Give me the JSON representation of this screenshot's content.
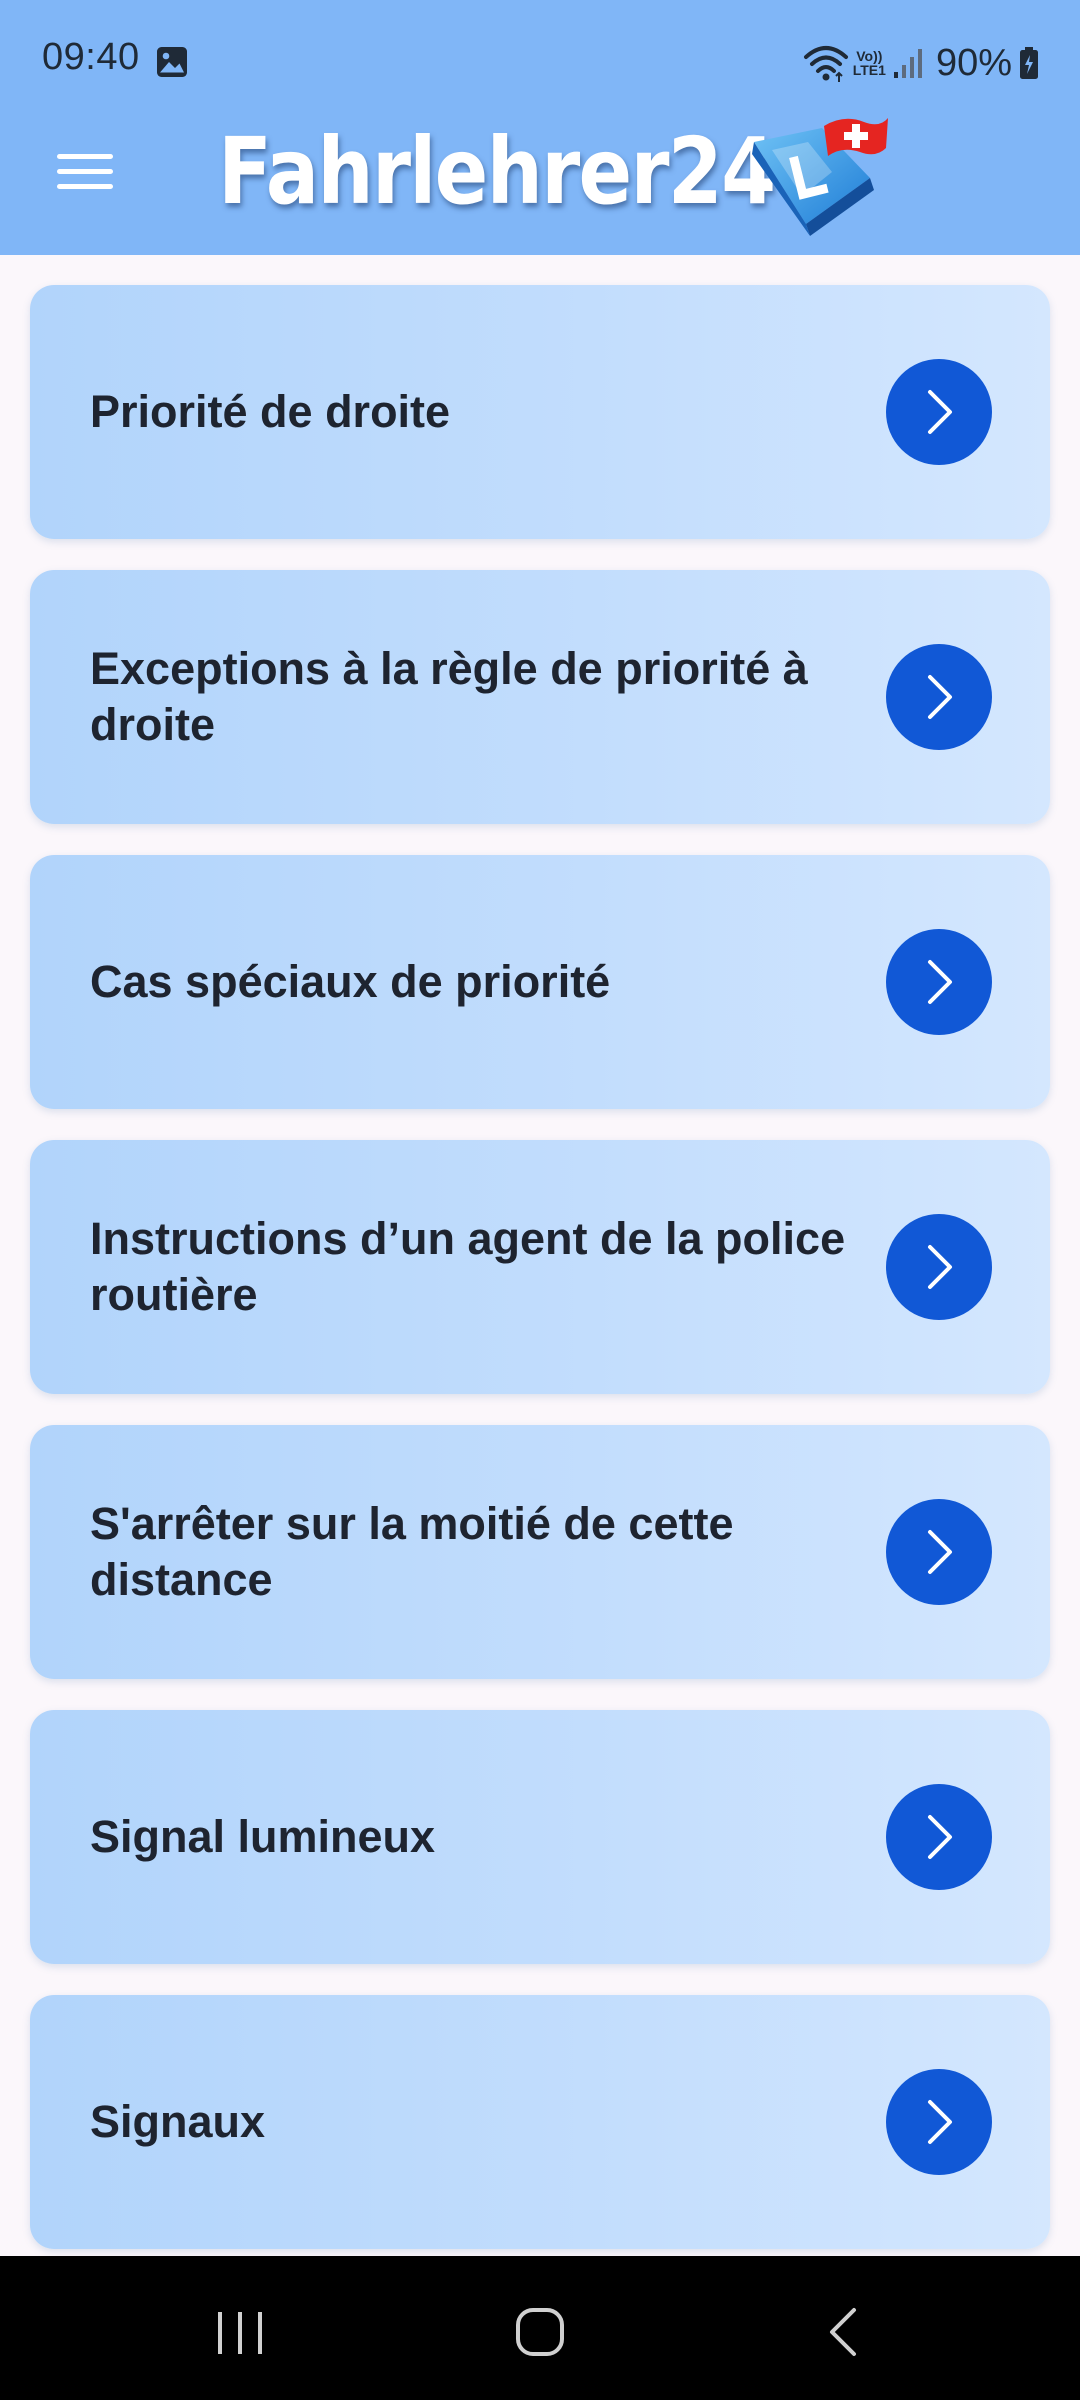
{
  "status_bar": {
    "time": "09:40",
    "network_label_top": "Vo))",
    "network_label_bottom": "LTE1",
    "battery_percent": "90%",
    "icons": [
      "gallery-icon",
      "wifi-icon",
      "signal-icon",
      "battery-charging-icon"
    ]
  },
  "app_bar": {
    "title": "Fahrlehrer24",
    "menu_icon": "hamburger-menu-icon",
    "logo_icon": "driving-school-l-plate-swiss-flag-logo"
  },
  "colors": {
    "app_bar": "#80b6f7",
    "card_start": "#b1d4fb",
    "card_end": "#d4e7fe",
    "arrow_button": "#1158d6",
    "text": "#1e2430",
    "background": "#fbf7fb"
  },
  "topics": [
    {
      "label": "Priorité de droite"
    },
    {
      "label": "Exceptions à la règle de priorité à droite"
    },
    {
      "label": "Cas spéciaux de priorité"
    },
    {
      "label": "Instructions d’un agent de la police routière"
    },
    {
      "label": "S'arrêter sur la moitié de cette distance"
    },
    {
      "label": "Signal lumineux"
    },
    {
      "label": "Signaux"
    }
  ],
  "nav_bar": {
    "icons": [
      "recent-apps-icon",
      "home-icon",
      "back-icon"
    ]
  }
}
